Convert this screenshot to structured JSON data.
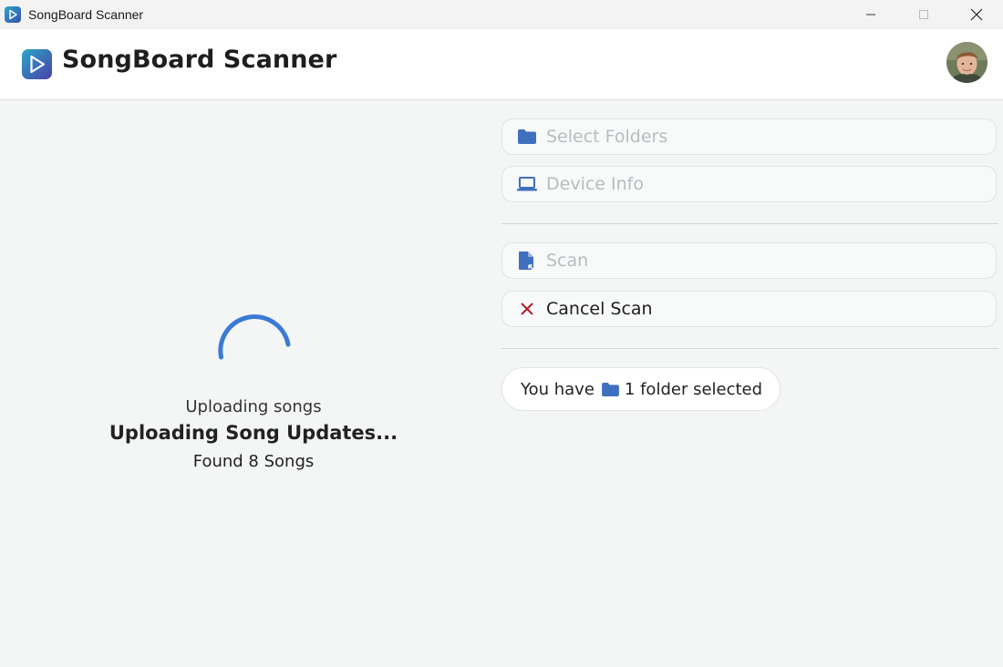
{
  "window": {
    "title": "SongBoard Scanner"
  },
  "header": {
    "app_name": "SongBoard Scanner"
  },
  "status": {
    "subtitle": "Uploading songs",
    "heading": "Uploading Song Updates...",
    "count_text": "Found 8 Songs"
  },
  "actions": {
    "select_folders": "Select Folders",
    "device_info": "Device Info",
    "scan": "Scan",
    "cancel_scan": "Cancel Scan"
  },
  "selection": {
    "prefix": "You have",
    "suffix": "1 folder selected"
  },
  "colors": {
    "accent": "#3f6fbf",
    "spinner": "#3a7bd5",
    "cancel": "#b01c2e",
    "disabled_text": "#b8bcc0"
  },
  "icons": [
    "app-logo-icon",
    "minimize-icon",
    "maximize-icon",
    "close-icon",
    "folder-icon",
    "laptop-icon",
    "scan-file-icon",
    "cancel-icon"
  ]
}
